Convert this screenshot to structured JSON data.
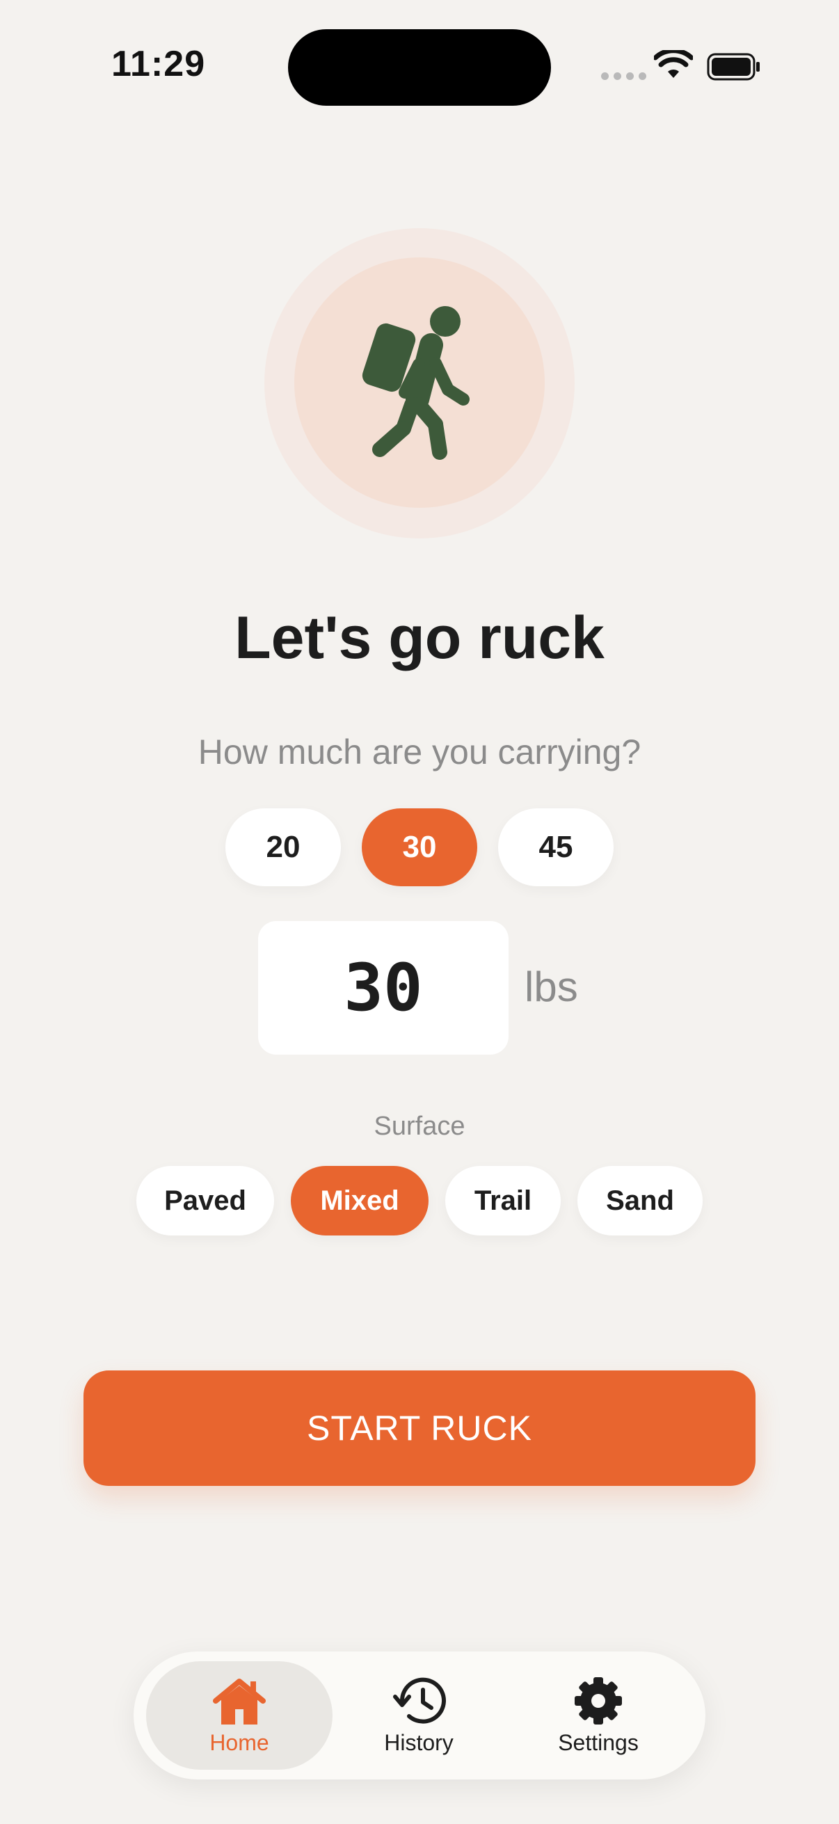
{
  "status_bar": {
    "time": "11:29"
  },
  "hero": {
    "icon": "hiker-with-backpack-icon"
  },
  "title": "Let's go ruck",
  "subtitle": "How much are you carrying?",
  "weight_presets": [
    "20",
    "30",
    "45"
  ],
  "selected_preset": "30",
  "weight_input": {
    "value": "30",
    "unit": "lbs"
  },
  "surface": {
    "label": "Surface",
    "options": [
      "Paved",
      "Mixed",
      "Trail",
      "Sand"
    ],
    "selected": "Mixed"
  },
  "start_button": {
    "label": "START RUCK"
  },
  "tab_bar": {
    "tabs": [
      {
        "label": "Home",
        "icon": "home-icon",
        "active": true
      },
      {
        "label": "History",
        "icon": "history-icon",
        "active": false
      },
      {
        "label": "Settings",
        "icon": "gear-icon",
        "active": false
      }
    ]
  },
  "colors": {
    "accent": "#e8652f",
    "hiker": "#3d5a3a",
    "background": "#f4f2ef"
  }
}
